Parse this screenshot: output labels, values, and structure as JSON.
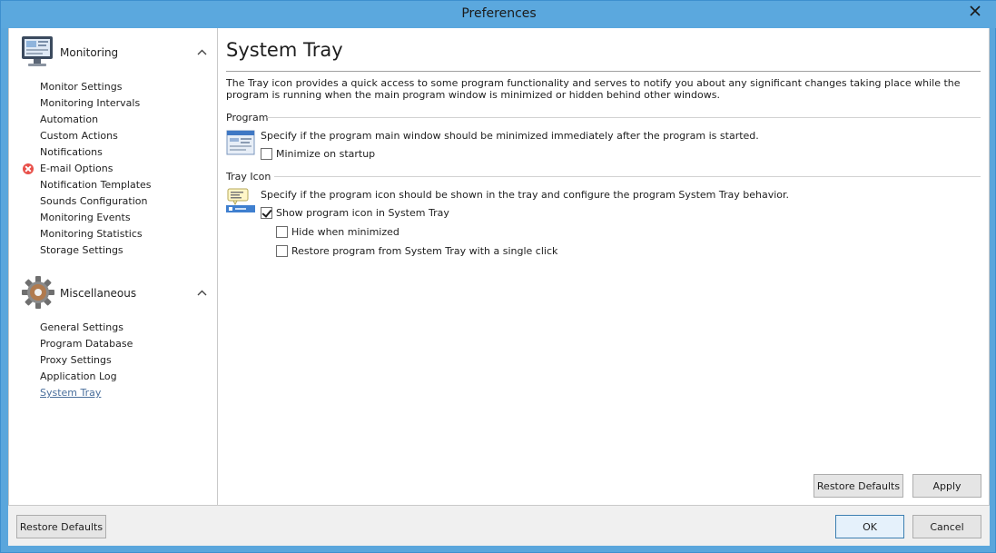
{
  "window": {
    "title": "Preferences"
  },
  "sidebar": {
    "groups": [
      {
        "label": "Monitoring",
        "icon": "monitor-icon",
        "items": [
          {
            "label": "Monitor Settings"
          },
          {
            "label": "Monitoring Intervals"
          },
          {
            "label": "Automation"
          },
          {
            "label": "Custom Actions"
          },
          {
            "label": "Notifications"
          },
          {
            "label": "E-mail Options",
            "status": "error"
          },
          {
            "label": "Notification Templates"
          },
          {
            "label": "Sounds Configuration"
          },
          {
            "label": "Monitoring Events"
          },
          {
            "label": "Monitoring Statistics"
          },
          {
            "label": "Storage Settings"
          }
        ]
      },
      {
        "label": "Miscellaneous",
        "icon": "gear-icon",
        "items": [
          {
            "label": "General Settings"
          },
          {
            "label": "Program Database"
          },
          {
            "label": "Proxy Settings"
          },
          {
            "label": "Application Log"
          },
          {
            "label": "System Tray",
            "active": true
          }
        ]
      }
    ]
  },
  "main": {
    "title": "System Tray",
    "description": "The Tray icon provides a quick access to some program functionality and serves to notify you about any significant changes taking place while the program is running when the main program window is minimized or hidden behind other windows.",
    "program": {
      "label": "Program",
      "text": "Specify if the program main window should be minimized immediately after the program is started.",
      "minimize_on_startup": {
        "label": "Minimize on startup",
        "checked": false
      }
    },
    "tray_icon": {
      "label": "Tray Icon",
      "text": "Specify if the program icon should be shown in the tray and configure the program System Tray behavior.",
      "show_icon": {
        "label": "Show program icon in System Tray",
        "checked": true
      },
      "hide_when_minimized": {
        "label": "Hide when minimized",
        "checked": false
      },
      "restore_single_click": {
        "label": "Restore program from System Tray with a single click",
        "checked": false
      }
    },
    "restore_defaults_label": "Restore Defaults",
    "apply_label": "Apply"
  },
  "footer": {
    "restore_defaults_label": "Restore Defaults",
    "ok_label": "OK",
    "cancel_label": "Cancel"
  },
  "colors": {
    "titlebar": "#5ba8de",
    "active_link": "#4a6f9c",
    "error": "#e8504a"
  }
}
